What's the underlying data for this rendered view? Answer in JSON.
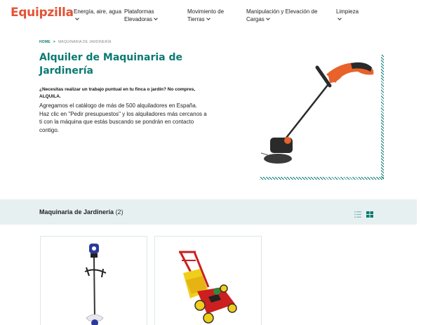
{
  "brand": {
    "logo": "Equipzilla",
    "color": "#e35336",
    "accent": "#0a7a73"
  },
  "nav": {
    "items": [
      {
        "label_line1": "Energía, aire, agua",
        "label_line2": "",
        "icon": "chevron-down-icon"
      },
      {
        "label_line1": "Plataformas",
        "label_line2": "Elevadoras",
        "icon": "chevron-down-icon"
      },
      {
        "label_line1": "Movimiento de",
        "label_line2": "Tierras",
        "icon": "chevron-down-icon"
      },
      {
        "label_line1": "Manipulación y Elevación de",
        "label_line2": "Cargas",
        "icon": "chevron-down-icon"
      },
      {
        "label_line1": "Limpieza",
        "label_line2": "",
        "icon": "chevron-down-icon"
      }
    ]
  },
  "breadcrumb": {
    "home": "HOME",
    "separator": ">",
    "current": "MAQUINARIA DE JARDINERÍA"
  },
  "hero": {
    "title": "Alquiler de Maquinaria de Jardinería",
    "lead": "¿Necesitas realizar un trabajo puntual en tu finca o jardín? No compres, ALQUILA.",
    "description": "Agregamos el catálogo de más de 500 alquiladores en España. Haz clic en \"Pedir presupuestos\" y los alquiladores más cercanos a ti con la máquina que estás buscando se pondrán en contacto contigo.",
    "image": "string-trimmer-image"
  },
  "category": {
    "title": "Maquinaria de Jardinería",
    "count": "(2)",
    "view_list_icon": "list-view-icon",
    "view_grid_icon": "grid-view-icon"
  },
  "products": [
    {
      "image": "brush-cutter-image"
    },
    {
      "image": "lawn-mower-image"
    }
  ]
}
